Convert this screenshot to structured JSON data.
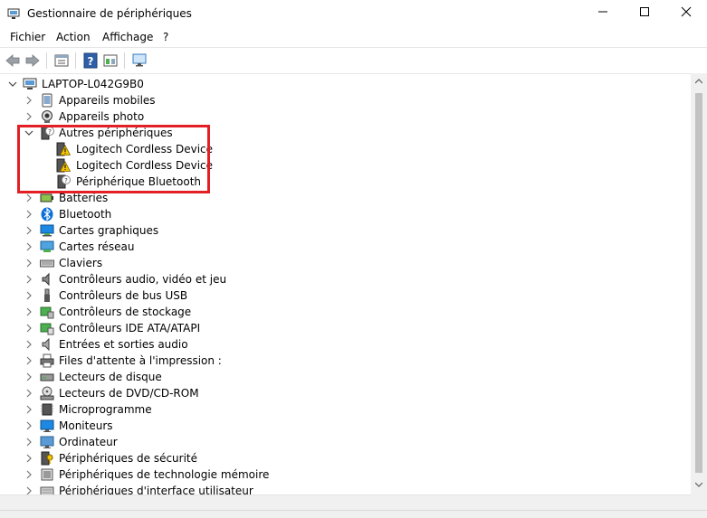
{
  "window": {
    "title": "Gestionnaire de périphériques",
    "controls": {
      "minimize": "—",
      "maximize": "☐",
      "close": "✕"
    }
  },
  "menu": [
    "Fichier",
    "Action",
    "Affichage",
    "?"
  ],
  "toolbar": {
    "icons": [
      "back-arrow-icon",
      "forward-arrow-icon",
      "properties-icon",
      "help-icon",
      "update-driver-icon",
      "monitor-scan-icon"
    ]
  },
  "tree": {
    "root": "LAPTOP-L042G9B0",
    "categories": [
      {
        "label": "Appareils mobiles",
        "icon": "mobile-device-icon",
        "expanded": false
      },
      {
        "label": "Appareils photo",
        "icon": "camera-icon",
        "expanded": false
      },
      {
        "label": "Autres périphériques",
        "icon": "unknown-device-icon",
        "expanded": true,
        "children": [
          {
            "label": "Logitech Cordless Device",
            "icon": "warning-device-icon"
          },
          {
            "label": "Logitech Cordless Device",
            "icon": "warning-device-icon"
          },
          {
            "label": "Périphérique Bluetooth",
            "icon": "unknown-device-icon"
          }
        ]
      },
      {
        "label": "Batteries",
        "icon": "battery-icon",
        "expanded": false
      },
      {
        "label": "Bluetooth",
        "icon": "bluetooth-icon",
        "expanded": false
      },
      {
        "label": "Cartes graphiques",
        "icon": "display-adapter-icon",
        "expanded": false
      },
      {
        "label": "Cartes réseau",
        "icon": "network-adapter-icon",
        "expanded": false
      },
      {
        "label": "Claviers",
        "icon": "keyboard-icon",
        "expanded": false
      },
      {
        "label": "Contrôleurs audio, vidéo et jeu",
        "icon": "audio-icon",
        "expanded": false
      },
      {
        "label": "Contrôleurs de bus USB",
        "icon": "usb-icon",
        "expanded": false
      },
      {
        "label": "Contrôleurs de stockage",
        "icon": "storage-controller-icon",
        "expanded": false
      },
      {
        "label": "Contrôleurs IDE ATA/ATAPI",
        "icon": "ide-controller-icon",
        "expanded": false
      },
      {
        "label": "Entrées et sorties audio",
        "icon": "speaker-icon",
        "expanded": false
      },
      {
        "label": "Files d'attente à l'impression :",
        "icon": "printer-icon",
        "expanded": false
      },
      {
        "label": "Lecteurs de disque",
        "icon": "disk-drive-icon",
        "expanded": false
      },
      {
        "label": "Lecteurs de DVD/CD-ROM",
        "icon": "dvd-drive-icon",
        "expanded": false
      },
      {
        "label": "Microprogramme",
        "icon": "firmware-icon",
        "expanded": false
      },
      {
        "label": "Moniteurs",
        "icon": "monitor-icon",
        "expanded": false
      },
      {
        "label": "Ordinateur",
        "icon": "computer-icon",
        "expanded": false
      },
      {
        "label": "Périphériques de sécurité",
        "icon": "security-device-icon",
        "expanded": false
      },
      {
        "label": "Périphériques de technologie mémoire",
        "icon": "memory-device-icon",
        "expanded": false
      },
      {
        "label": "Périphériques d'interface utilisateur",
        "icon": "hid-device-icon",
        "expanded": false
      }
    ]
  },
  "colors": {
    "highlight": "#e31e24",
    "warning": "#f5c400",
    "bluetooth": "#0a6fd6",
    "monitor": "#1e88e5"
  }
}
